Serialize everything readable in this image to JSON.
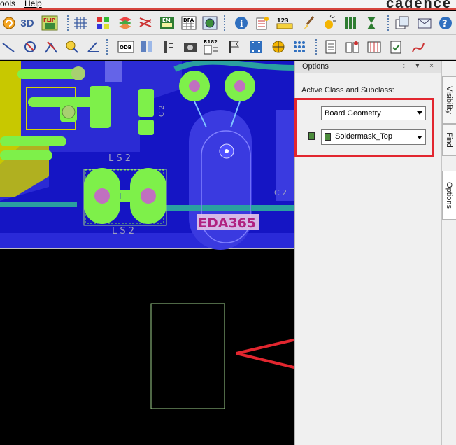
{
  "menu": {
    "tools_label": "ools",
    "help_label": "Help",
    "brand": "cadence"
  },
  "toolbar1": {
    "icons": [
      "undo-icon",
      "3d-view-icon",
      "flip-icon",
      "grid-icon",
      "color-icon",
      "layers-icon",
      "fm-icon",
      "dfa-icon",
      "globe-icon",
      "info-icon",
      "property-icon",
      "measure-icon",
      "brush-icon",
      "light-icon",
      "bars-icon",
      "hourglass-icon",
      "windows-icon",
      "mail-icon",
      "help-icon"
    ],
    "labels": {
      "flip": "FLIP",
      "fm": "EM",
      "dfa": "DFA",
      "measure": "123"
    }
  },
  "toolbar2": {
    "icons": [
      "line-icon",
      "circle-icon",
      "trim-icon",
      "zoom-icon",
      "angle-icon",
      "odb-icon",
      "split-icon",
      "wrench-icon",
      "camera-icon",
      "r182-icon",
      "flag-icon",
      "select-icon",
      "tp-icon",
      "array-icon",
      "doc-icon",
      "book-icon",
      "shelf-icon",
      "check-icon",
      "route-icon"
    ],
    "labels": {
      "odb": "ODB",
      "r182": "R182"
    }
  },
  "canvas": {
    "watermark": "EDA365",
    "refdes": [
      "L S 2",
      "L S 2",
      "L",
      "C 2",
      "C 2"
    ],
    "colors": {
      "board": "#1515c4",
      "copper": "#7ef04a",
      "silk": "#d4d400",
      "outline": "#9ecf8c",
      "background": "#000000",
      "arrow": "#e2262f"
    }
  },
  "options_panel": {
    "title": "Options",
    "controls": "↕ ▾ ×",
    "active_class_label": "Active Class and Subclass:",
    "class_value": "Board Geometry",
    "subclass_value": "Soldermask_Top",
    "subclass_color": "#4c8c3c"
  },
  "vertical_tabs": [
    "Visibility",
    "Find",
    "Options"
  ]
}
